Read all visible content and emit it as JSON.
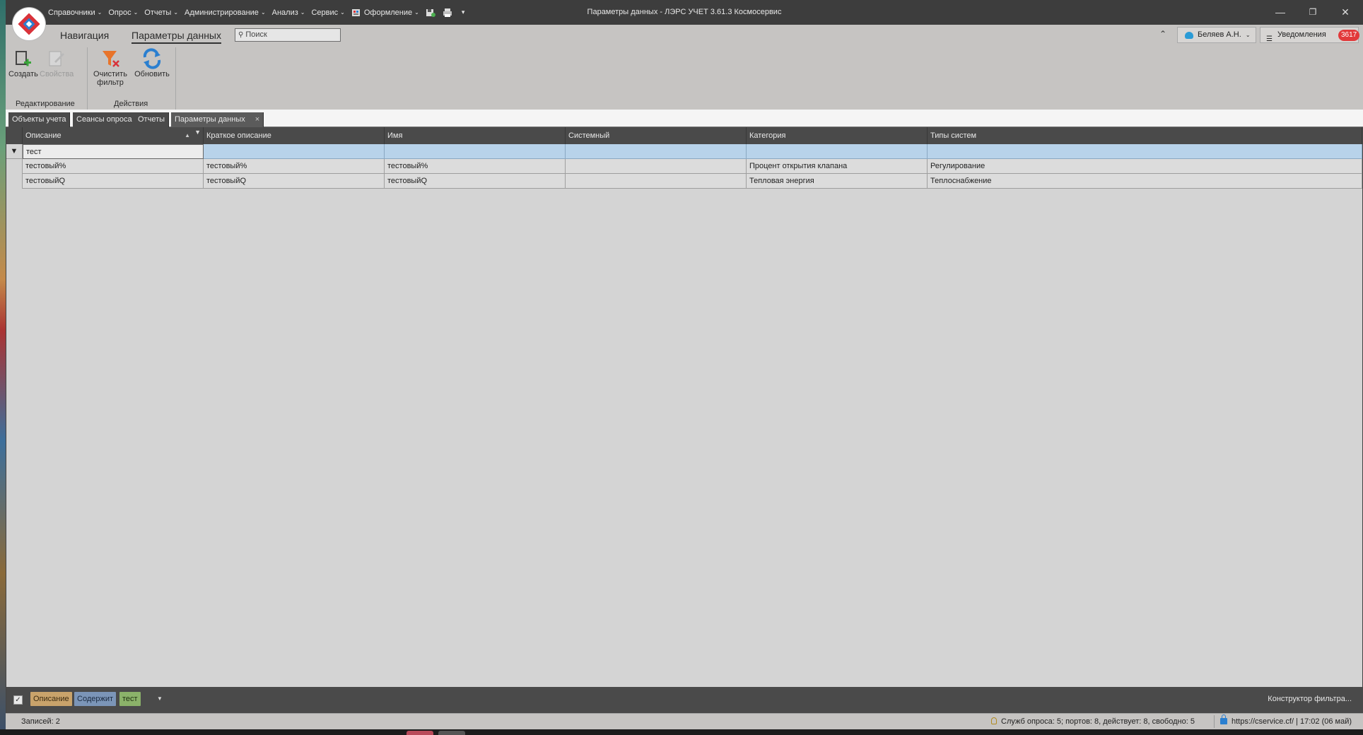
{
  "window": {
    "title": "Параметры данных - ЛЭРС УЧЕТ 3.61.3 Космосервис",
    "controls": {
      "minimize": "—",
      "restore": "❐",
      "close": "✕"
    }
  },
  "menu": [
    {
      "label": "Справочники",
      "chevron": "⌵"
    },
    {
      "label": "Опрос",
      "chevron": "⌵"
    },
    {
      "label": "Отчеты",
      "chevron": "⌵"
    },
    {
      "label": "Администрирование",
      "chevron": "⌵"
    },
    {
      "label": "Анализ",
      "chevron": "⌵"
    },
    {
      "label": "Сервис",
      "chevron": "⌵"
    },
    {
      "label": "Оформление",
      "chevron": "⌵"
    }
  ],
  "ribbon": {
    "tabs": [
      "Навигация",
      "Параметры данных"
    ],
    "search_placeholder": "Поиск",
    "user_label": "Беляев А.Н.",
    "notifications_label": "Уведомления",
    "notifications_count": "3617",
    "buttons": {
      "create": "Создать",
      "properties": "Свойства",
      "clear_filter_1": "Очистить",
      "clear_filter_2": "фильтр",
      "refresh": "Обновить"
    },
    "groups": {
      "edit": "Редактирование",
      "actions": "Действия"
    }
  },
  "doc_tabs": [
    "Объекты учета",
    "Сеансы опроса",
    "Отчеты",
    "Параметры данных"
  ],
  "grid": {
    "columns": [
      "Описание",
      "Краткое описание",
      "Имя",
      "Системный",
      "Категория",
      "Типы систем"
    ],
    "filter_value": "тест",
    "rows": [
      [
        "тестовый%",
        "тестовый%",
        "тестовый%",
        "",
        "Процент открытия клапана",
        "Регулирование"
      ],
      [
        "тестовыйQ",
        "тестовыйQ",
        "тестовыйQ",
        "",
        "Тепловая энергия",
        "Теплоснабжение"
      ]
    ]
  },
  "filter_panel": {
    "field": "Описание",
    "operator": "Содержит",
    "value": "тест",
    "builder_label": "Конструктор фильтра..."
  },
  "status": {
    "records": "Записей: 2",
    "services": "Служб опроса: 5; портов: 8, действует: 8, свободно: 5",
    "server": "https://cservice.cf/ | 17:02 (06 май)"
  },
  "colors": {
    "titlebar": "#3d3d3d",
    "ribbon": "#c6c4c2",
    "grid_header": "#4a4a4a",
    "filter_row": "#b8d3ea",
    "badge": "#e2393a",
    "accent_blue": "#2a7fd0",
    "accent_orange": "#e8742a"
  }
}
